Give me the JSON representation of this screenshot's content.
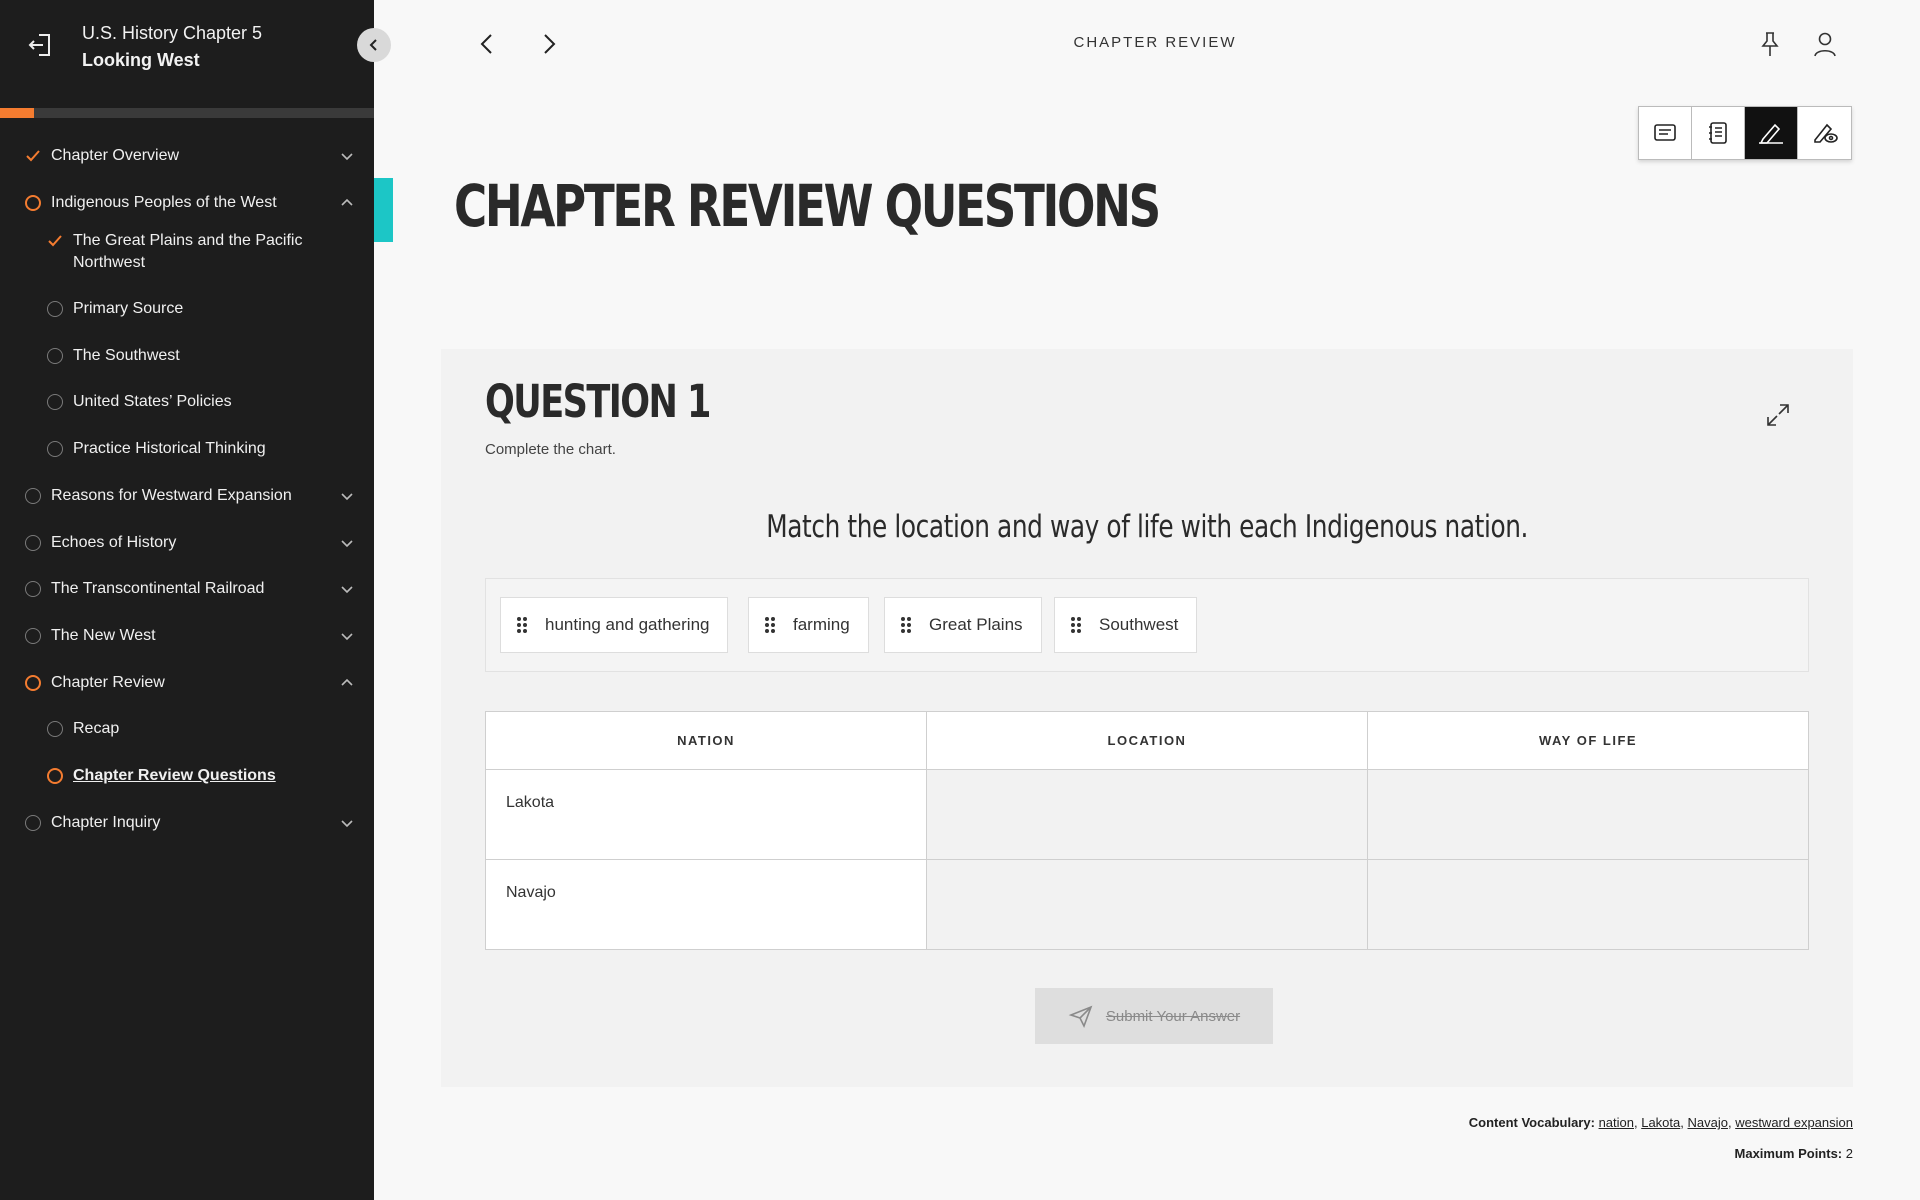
{
  "book": {
    "course": "U.S. History Chapter 5",
    "chapter": "Looking West"
  },
  "progress": {
    "fraction": 0.09
  },
  "nav": {
    "items": [
      {
        "label": "Chapter Overview",
        "status": "done",
        "level": "top",
        "chevron": "down"
      },
      {
        "label": "Indigenous Peoples of the West",
        "status": "active",
        "level": "top",
        "chevron": "up"
      },
      {
        "label": "The Great Plains and the Pacific Northwest",
        "status": "done",
        "level": "sub"
      },
      {
        "label": "Primary Source",
        "status": "empty",
        "level": "sub"
      },
      {
        "label": "The Southwest",
        "status": "empty",
        "level": "sub"
      },
      {
        "label": "United States’ Policies",
        "status": "empty",
        "level": "sub"
      },
      {
        "label": "Practice Historical Thinking",
        "status": "empty",
        "level": "sub"
      },
      {
        "label": "Reasons for Westward Expansion",
        "status": "empty",
        "level": "top",
        "chevron": "down"
      },
      {
        "label": "Echoes of History",
        "status": "empty",
        "level": "top",
        "chevron": "down"
      },
      {
        "label": "The Transcontinental Railroad",
        "status": "empty",
        "level": "top",
        "chevron": "down"
      },
      {
        "label": "The New West",
        "status": "empty",
        "level": "top",
        "chevron": "down"
      },
      {
        "label": "Chapter Review",
        "status": "active",
        "level": "top",
        "chevron": "up"
      },
      {
        "label": "Recap",
        "status": "empty",
        "level": "sub"
      },
      {
        "label": "Chapter Review Questions",
        "status": "active",
        "level": "sub",
        "current": true
      },
      {
        "label": "Chapter Inquiry",
        "status": "empty",
        "level": "top",
        "chevron": "down"
      }
    ]
  },
  "topbar": {
    "section": "CHAPTER REVIEW"
  },
  "page": {
    "title": "CHAPTER REVIEW QUESTIONS"
  },
  "question": {
    "title": "QUESTION 1",
    "instruction": "Complete the chart.",
    "prompt": "Match the location and way of life with each Indigenous nation.",
    "chips": [
      "hunting and gathering",
      "farming",
      "Great Plains",
      "Southwest"
    ],
    "columns": [
      "NATION",
      "LOCATION",
      "WAY OF LIFE"
    ],
    "rows": [
      "Lakota",
      "Navajo"
    ],
    "submit_label": "Submit Your Answer"
  },
  "footer": {
    "vocab_label": "Content Vocabulary:",
    "vocab": [
      "nation",
      "Lakota",
      "Navajo",
      "westward expansion"
    ],
    "points_label": "Maximum Points:",
    "points_value": "2"
  },
  "colors": {
    "accent": "#f47c30",
    "teal": "#1cc6c6",
    "sidebar": "#1d1d1d"
  }
}
